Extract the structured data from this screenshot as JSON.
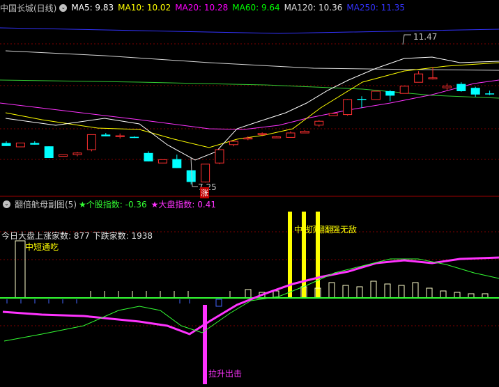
{
  "main_panel": {
    "title": "中国长城(日线)",
    "indicators": [
      {
        "label": "MA5: 9.83",
        "color": "#ffffff"
      },
      {
        "label": "MA10: 10.02",
        "color": "#ffff00"
      },
      {
        "label": "MA20: 10.28",
        "color": "#ff00ff"
      },
      {
        "label": "MA60: 9.64",
        "color": "#00ff00"
      },
      {
        "label": "MA120: 10.36",
        "color": "#e0e0e0"
      },
      {
        "label": "MA250: 11.35",
        "color": "#3333ff"
      }
    ],
    "high_label": "11.47",
    "low_label": "7.25",
    "zhang_label": "涨"
  },
  "sub_panel": {
    "title": "翻倍航母副图(5)",
    "star1": "★个股指数: -0.36",
    "star2": "★大盘指数: 0.41",
    "stats": "今日大盘上涨家数: 877 下跌家数: 1938",
    "label_zhongduan": "中短通吃",
    "label_overlap1": "中",
    "label_overlap2": "线",
    "label_overlap3": "顶",
    "label_overlap4": "翻翻",
    "label_overlap5": "强无敌",
    "label_lasheng": "拉升出击"
  },
  "colors": {
    "up": "#ff3030",
    "down": "#00ffff",
    "grid": "#800000",
    "yellow": "#ffff00",
    "magenta": "#ff33ff",
    "green": "#33ff33"
  },
  "chart_data": {
    "type": "candlestick",
    "candles": [
      {
        "o": 8.74,
        "h": 8.8,
        "l": 8.63,
        "c": 8.63
      },
      {
        "o": 8.6,
        "h": 8.74,
        "l": 8.6,
        "c": 8.74
      },
      {
        "o": 8.74,
        "h": 8.8,
        "l": 8.68,
        "c": 8.68
      },
      {
        "o": 8.62,
        "h": 8.62,
        "l": 8.2,
        "c": 8.2
      },
      {
        "o": 8.26,
        "h": 8.32,
        "l": 8.26,
        "c": 8.32
      },
      {
        "o": 8.32,
        "h": 8.42,
        "l": 8.26,
        "c": 8.38
      },
      {
        "o": 8.5,
        "h": 9.04,
        "l": 8.44,
        "c": 9.04
      },
      {
        "o": 9.04,
        "h": 9.1,
        "l": 8.98,
        "c": 8.98
      },
      {
        "o": 8.98,
        "h": 9.08,
        "l": 8.9,
        "c": 9.0
      },
      {
        "o": 8.96,
        "h": 8.98,
        "l": 8.92,
        "c": 8.92
      },
      {
        "o": 8.38,
        "h": 8.44,
        "l": 8.08,
        "c": 8.08
      },
      {
        "o": 8.02,
        "h": 8.14,
        "l": 8.02,
        "c": 8.14
      },
      {
        "o": 8.16,
        "h": 8.32,
        "l": 7.84,
        "c": 7.84
      },
      {
        "o": 7.76,
        "h": 7.76,
        "l": 7.25,
        "c": 7.34
      },
      {
        "o": 7.34,
        "h": 7.98,
        "l": 7.32,
        "c": 7.98
      },
      {
        "o": 8.02,
        "h": 8.52,
        "l": 7.98,
        "c": 8.5
      },
      {
        "o": 8.68,
        "h": 8.82,
        "l": 8.62,
        "c": 8.8
      },
      {
        "o": 8.9,
        "h": 8.98,
        "l": 8.84,
        "c": 8.92
      },
      {
        "o": 9.08,
        "h": 9.12,
        "l": 8.98,
        "c": 9.08
      },
      {
        "o": 8.96,
        "h": 8.98,
        "l": 8.94,
        "c": 8.96
      },
      {
        "o": 8.94,
        "h": 9.16,
        "l": 8.94,
        "c": 9.1
      },
      {
        "o": 9.1,
        "h": 9.2,
        "l": 9.1,
        "c": 9.16
      },
      {
        "o": 9.38,
        "h": 9.56,
        "l": 9.32,
        "c": 9.52
      },
      {
        "o": 9.72,
        "h": 9.8,
        "l": 9.72,
        "c": 9.8
      },
      {
        "o": 9.76,
        "h": 10.32,
        "l": 9.72,
        "c": 10.3
      },
      {
        "o": 10.32,
        "h": 10.42,
        "l": 10.0,
        "c": 10.3
      },
      {
        "o": 10.3,
        "h": 10.6,
        "l": 10.3,
        "c": 10.6
      },
      {
        "o": 10.6,
        "h": 10.64,
        "l": 10.24,
        "c": 10.44
      },
      {
        "o": 10.52,
        "h": 10.8,
        "l": 10.52,
        "c": 10.78
      },
      {
        "o": 10.92,
        "h": 11.32,
        "l": 10.92,
        "c": 11.22
      },
      {
        "o": 11.08,
        "h": 11.47,
        "l": 11.02,
        "c": 11.08
      },
      {
        "o": 10.72,
        "h": 10.88,
        "l": 10.62,
        "c": 10.78
      },
      {
        "o": 10.86,
        "h": 10.92,
        "l": 10.58,
        "c": 10.6
      },
      {
        "o": 10.72,
        "h": 10.76,
        "l": 10.4,
        "c": 10.48
      },
      {
        "o": 10.52,
        "h": 10.62,
        "l": 10.46,
        "c": 10.5
      },
      {
        "o": 10.6,
        "h": 10.8,
        "l": 10.52,
        "c": 10.68
      },
      {
        "o": 10.76,
        "h": 10.92,
        "l": 10.7,
        "c": 10.9
      }
    ]
  }
}
